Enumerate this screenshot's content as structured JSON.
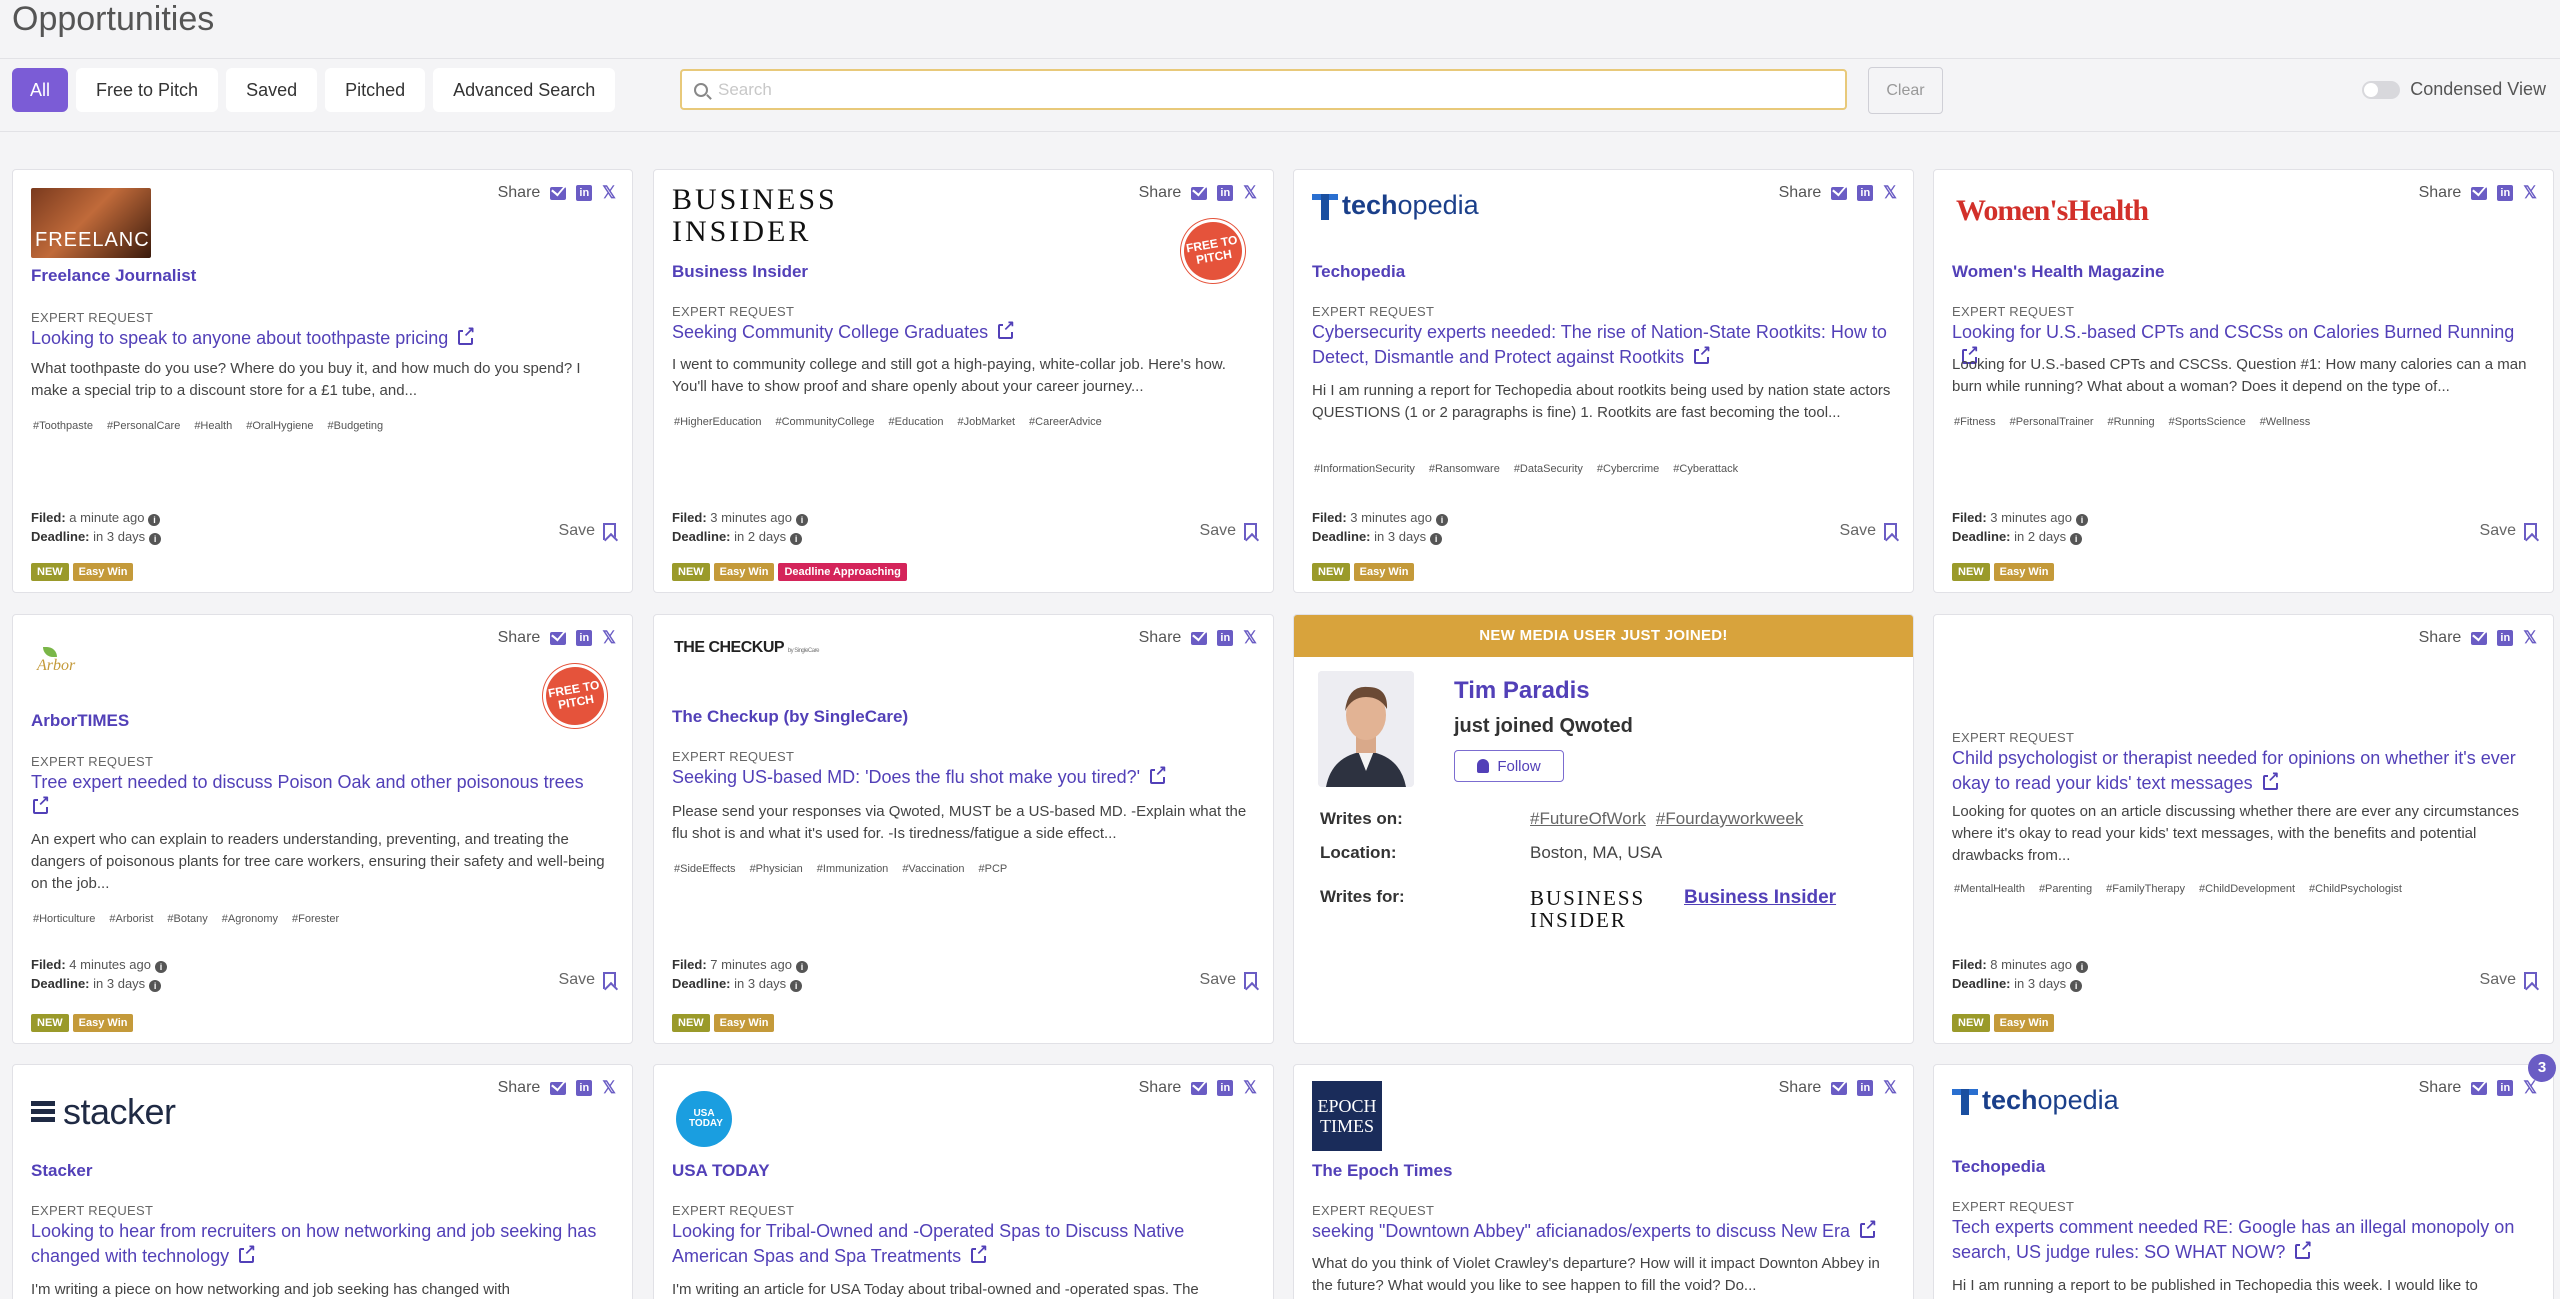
{
  "page_title": "Opportunities",
  "tabs": [
    "All",
    "Free to Pitch",
    "Saved",
    "Pitched",
    "Advanced Search"
  ],
  "search": {
    "placeholder": "Search",
    "clear_label": "Clear"
  },
  "condensed_label": "Condensed View",
  "share_label": "Share",
  "save_label": "Save",
  "expert_label": "EXPERT REQUEST",
  "free_to_pitch_badge": "FREE TO PITCH",
  "badges": {
    "new": "NEW",
    "easy": "Easy Win",
    "deadline": "Deadline Approaching"
  },
  "notification_count": "3",
  "logos": {
    "freelance": "FREELANCE",
    "business_insider": "BUSINESS INSIDER",
    "techopedia_prefix": "tech",
    "techopedia_suffix": "opedia",
    "womens_health": "Women'sHealth",
    "arbor": "Arbor",
    "checkup": "THE CHECKUP",
    "checkup_by": "by SingleCare",
    "stacker": "stacker",
    "usa_today": "USA TODAY",
    "epoch": "EPOCH TIMES"
  },
  "cards": [
    {
      "outlet": "Freelance Journalist",
      "title": "Looking to speak to anyone about toothpaste pricing",
      "desc": "What toothpaste do you use? Where do you buy it, and how much do you spend? I make a special trip to a discount store for a £1 tube, and...",
      "tags": [
        "#Toothpaste",
        "#PersonalCare",
        "#Health",
        "#OralHygiene",
        "#Budgeting"
      ],
      "filed": "a minute ago",
      "deadline": "in 3 days"
    },
    {
      "outlet": "Business Insider",
      "title": "Seeking Community College Graduates",
      "desc": "I went to community college and still got a high-paying, white-collar job. Here's how. You'll have to show proof and share openly about your career journey...",
      "tags": [
        "#HigherEducation",
        "#CommunityCollege",
        "#Education",
        "#JobMarket",
        "#CareerAdvice"
      ],
      "filed": "3 minutes ago",
      "deadline": "in 2 days"
    },
    {
      "outlet": "Techopedia",
      "title": "Cybersecurity experts needed: The rise of Nation-State Rootkits: How to Detect, Dismantle and Protect against Rootkits",
      "desc": "Hi I am running a report for Techopedia about rootkits being used by nation state actors QUESTIONS (1 or 2 paragraphs is fine) 1. Rootkits are fast becoming the tool...",
      "tags": [
        "#InformationSecurity",
        "#Ransomware",
        "#DataSecurity",
        "#Cybercrime",
        "#Cyberattack"
      ],
      "filed": "3 minutes ago",
      "deadline": "in 3 days"
    },
    {
      "outlet": "Women's Health Magazine",
      "title": "Looking for U.S.-based CPTs and CSCSs on Calories Burned Running",
      "desc": "Looking for U.S.-based CPTs and CSCSs. Question #1: How many calories can a man burn while running? What about a woman? Does it depend on the type of...",
      "tags": [
        "#Fitness",
        "#PersonalTrainer",
        "#Running",
        "#SportsScience",
        "#Wellness"
      ],
      "filed": "3 minutes ago",
      "deadline": "in 2 days"
    },
    {
      "outlet": "ArborTIMES",
      "title": "Tree expert needed to discuss Poison Oak and other poisonous trees",
      "desc": "An expert who can explain to readers understanding, preventing, and treating the dangers of poisonous plants for tree care workers, ensuring their safety and well-being on the job...",
      "tags": [
        "#Horticulture",
        "#Arborist",
        "#Botany",
        "#Agronomy",
        "#Forester"
      ],
      "filed": "4 minutes ago",
      "deadline": "in 3 days"
    },
    {
      "outlet": "The Checkup (by SingleCare)",
      "title": "Seeking US-based MD: 'Does the flu shot make you tired?'",
      "desc": "Please send your responses via Qwoted, MUST be a US-based MD. -Explain what the flu shot is and what it's used for. -Is tiredness/fatigue a side effect...",
      "tags": [
        "#SideEffects",
        "#Physician",
        "#Immunization",
        "#Vaccination",
        "#PCP"
      ],
      "filed": "7 minutes ago",
      "deadline": "in 3 days"
    },
    {
      "outlet": "",
      "title": "Child psychologist or therapist needed for opinions on whether it's ever okay to read your kids' text messages",
      "desc": "Looking for quotes on an article discussing whether there are ever any circumstances where it's okay to read your kids' text messages, with the benefits and potential drawbacks from...",
      "tags": [
        "#MentalHealth",
        "#Parenting",
        "#FamilyTherapy",
        "#ChildDevelopment",
        "#ChildPsychologist"
      ],
      "filed": "8 minutes ago",
      "deadline": "in 3 days"
    },
    {
      "outlet": "Stacker",
      "title": "Looking to hear from recruiters on how networking and job seeking has changed with technology",
      "desc": "I'm writing a piece on how networking and job seeking has changed with"
    },
    {
      "outlet": "USA TODAY",
      "title": "Looking for Tribal-Owned and -Operated Spas to Discuss Native American Spas and Spa Treatments",
      "desc": "I'm writing an article for USA Today about tribal-owned and -operated spas. The"
    },
    {
      "outlet": "The Epoch Times",
      "title": "seeking \"Downtown Abbey\" aficianados/experts to discuss New Era",
      "desc": "What do you think of Violet Crawley's departure? How will it impact Downton Abbey in the future? What would you like to see happen to fill the void? Do..."
    },
    {
      "outlet": "Techopedia",
      "title": "Tech experts comment needed RE: Google has an illegal monopoly on search, US judge rules: SO WHAT NOW?",
      "desc": "Hi I am running a report to be published in Techopedia this week. I would like to"
    }
  ],
  "new_user": {
    "header": "NEW MEDIA USER JUST JOINED!",
    "name": "Tim Paradis",
    "subtitle": "just joined Qwoted",
    "follow_label": "Follow",
    "writes_on_label": "Writes on:",
    "writes_on": [
      "#FutureOfWork",
      "#Fourdayworkweek"
    ],
    "location_label": "Location:",
    "location": "Boston, MA, USA",
    "writes_for_label": "Writes for:",
    "writes_for": "Business Insider"
  },
  "filed_label": "Filed:",
  "deadline_label": "Deadline:",
  "colors": {
    "accent": "#7b5cd6",
    "link": "#5240b8",
    "banner": "#d8a33c",
    "free_badge": "#e5533b"
  }
}
